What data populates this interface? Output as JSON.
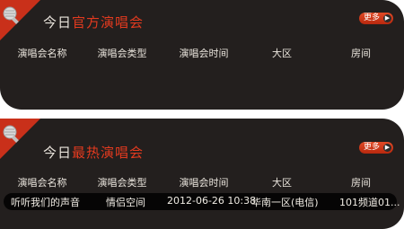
{
  "sections": [
    {
      "title_prefix": "今日",
      "title_highlight": "官方演唱会",
      "more_label": "更多",
      "columns": [
        "演唱会名称",
        "演唱会类型",
        "演唱会时间",
        "大区",
        "房间"
      ],
      "rows": []
    },
    {
      "title_prefix": "今日",
      "title_highlight": "最热演唱会",
      "more_label": "更多",
      "columns": [
        "演唱会名称",
        "演唱会类型",
        "演唱会时间",
        "大区",
        "房间"
      ],
      "rows": [
        {
          "name": "听听我们的声音",
          "type": "情侣空间",
          "time": "2012-06-26 10:38",
          "region": "华南一区(电信)",
          "room": "101频道01..."
        }
      ]
    }
  ],
  "colors": {
    "panel_bg": "#231f1e",
    "accent": "#e33a1f",
    "text": "#e9e4dc",
    "row_bg": "#060505"
  },
  "icons": {
    "corner": "microphone-icon",
    "more": "arrow-right-icon"
  }
}
